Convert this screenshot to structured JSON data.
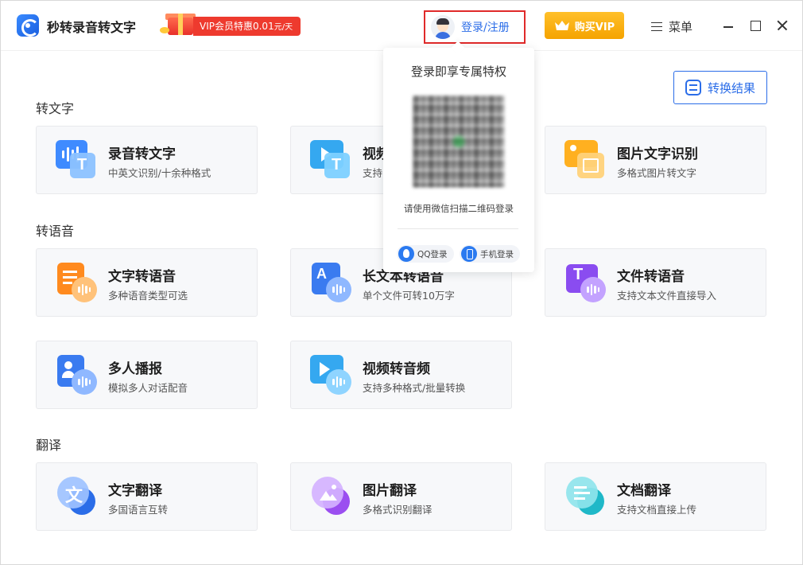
{
  "app": {
    "title": "秒转录音转文字",
    "vip_promo": "VIP会员特惠0.01",
    "vip_promo_unit": "元/天",
    "login_label": "登录/注册",
    "buy_vip_label": "购买VIP",
    "menu_label": "菜单"
  },
  "toolbar": {
    "convert_result_label": "转换结果"
  },
  "sections": {
    "to_text": "转文字",
    "to_speech": "转语音",
    "translate": "翻译"
  },
  "cards": {
    "audio_to_text": {
      "title": "录音转文字",
      "desc": "中英文识别/十余种格式"
    },
    "video_to_text": {
      "title": "视频转文字",
      "desc": "支持多种格式"
    },
    "image_ocr": {
      "title": "图片文字识别",
      "desc": "多格式图片转文字"
    },
    "text_to_speech": {
      "title": "文字转语音",
      "desc": "多种语音类型可选"
    },
    "long_text_to_speech": {
      "title": "长文本转语音",
      "desc": "单个文件可转10万字"
    },
    "file_to_speech": {
      "title": "文件转语音",
      "desc": "支持文本文件直接导入"
    },
    "multi_speaker": {
      "title": "多人播报",
      "desc": "模拟多人对话配音"
    },
    "video_to_audio": {
      "title": "视频转音频",
      "desc": "支持多种格式/批量转换"
    },
    "text_translate": {
      "title": "文字翻译",
      "desc": "多国语言互转"
    },
    "image_translate": {
      "title": "图片翻译",
      "desc": "多格式识别翻译"
    },
    "doc_translate": {
      "title": "文档翻译",
      "desc": "支持文档直接上传"
    }
  },
  "login_popup": {
    "title": "登录即享专属特权",
    "hint": "请使用微信扫描二维码登录",
    "qq_login": "QQ登录",
    "phone_login": "手机登录"
  },
  "colors": {
    "accent": "#2b6de8",
    "vip_gold": "#f5a300",
    "promo_red": "#ee3a2e",
    "highlight_border": "#e02a2a"
  }
}
